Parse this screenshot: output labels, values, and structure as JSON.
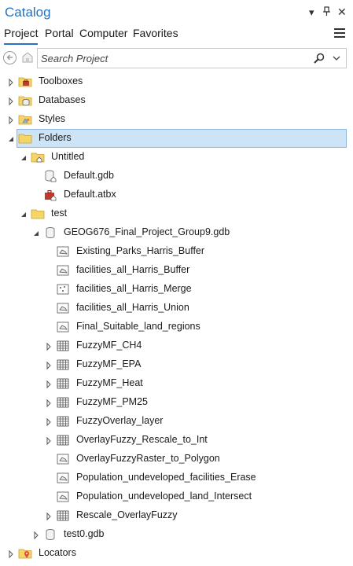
{
  "pane": {
    "title": "Catalog",
    "controls": {
      "dropdown": "▾",
      "pin": "†",
      "close": "✕"
    }
  },
  "tabs": [
    {
      "label": "Project",
      "active": true
    },
    {
      "label": "Portal",
      "active": false
    },
    {
      "label": "Computer",
      "active": false
    },
    {
      "label": "Favorites",
      "active": false
    }
  ],
  "search": {
    "placeholder": "Search Project",
    "value": ""
  },
  "tree": [
    {
      "label": "Toolboxes",
      "icon": "toolbox-folder-icon",
      "expander": "collapsed"
    },
    {
      "label": "Databases",
      "icon": "database-folder-icon",
      "expander": "collapsed"
    },
    {
      "label": "Styles",
      "icon": "styles-folder-icon",
      "expander": "collapsed"
    },
    {
      "label": "Folders",
      "icon": "folder-icon",
      "expander": "expanded",
      "selected": true
    },
    {
      "label": "Untitled",
      "icon": "home-folder-icon",
      "expander": "expanded"
    },
    {
      "label": "Default.gdb",
      "icon": "geodatabase-home-icon",
      "expander": "none"
    },
    {
      "label": "Default.atbx",
      "icon": "toolbox-home-icon",
      "expander": "none"
    },
    {
      "label": "test",
      "icon": "folder-icon",
      "expander": "expanded"
    },
    {
      "label": "GEOG676_Final_Project_Group9.gdb",
      "icon": "geodatabase-icon",
      "expander": "expanded"
    },
    {
      "label": "Existing_Parks_Harris_Buffer",
      "icon": "polygon-feature-class-icon",
      "expander": "none"
    },
    {
      "label": "facilities_all_Harris_Buffer",
      "icon": "polygon-feature-class-icon",
      "expander": "none"
    },
    {
      "label": "facilities_all_Harris_Merge",
      "icon": "point-feature-class-icon",
      "expander": "none"
    },
    {
      "label": "facilities_all_Harris_Union",
      "icon": "polygon-feature-class-icon",
      "expander": "none"
    },
    {
      "label": "Final_Suitable_land_regions",
      "icon": "polygon-feature-class-icon",
      "expander": "none"
    },
    {
      "label": "FuzzyMF_CH4",
      "icon": "raster-icon",
      "expander": "collapsed"
    },
    {
      "label": "FuzzyMF_EPA",
      "icon": "raster-icon",
      "expander": "collapsed"
    },
    {
      "label": "FuzzyMF_Heat",
      "icon": "raster-icon",
      "expander": "collapsed"
    },
    {
      "label": "FuzzyMF_PM25",
      "icon": "raster-icon",
      "expander": "collapsed"
    },
    {
      "label": "FuzzyOverlay_layer",
      "icon": "raster-icon",
      "expander": "collapsed"
    },
    {
      "label": "OverlayFuzzy_Rescale_to_Int",
      "icon": "raster-icon",
      "expander": "collapsed"
    },
    {
      "label": "OverlayFuzzyRaster_to_Polygon",
      "icon": "polygon-feature-class-icon",
      "expander": "none"
    },
    {
      "label": "Population_undeveloped_facilities_Erase",
      "icon": "polygon-feature-class-icon",
      "expander": "none"
    },
    {
      "label": "Population_undeveloped_land_Intersect",
      "icon": "polygon-feature-class-icon",
      "expander": "none"
    },
    {
      "label": "Rescale_OverlayFuzzy",
      "icon": "raster-icon",
      "expander": "collapsed"
    },
    {
      "label": "test0.gdb",
      "icon": "geodatabase-icon",
      "expander": "collapsed"
    },
    {
      "label": "Locators",
      "icon": "locator-folder-icon",
      "expander": "collapsed"
    }
  ]
}
